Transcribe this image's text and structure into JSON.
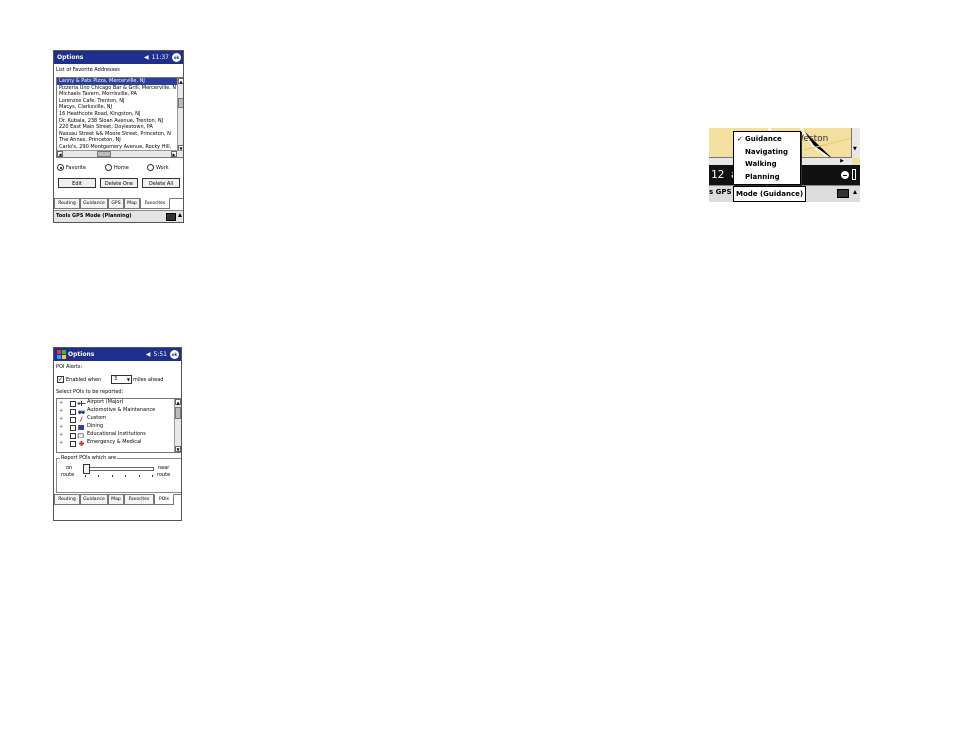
{
  "screen_favorites": {
    "title": "Options",
    "status": "◀  11:37",
    "ok_label": "ok",
    "list_label": "List of Favorite Addresses",
    "addresses": [
      "Lanny & Pats Pizza, Mercerville, NJ",
      "Pizzeria Uno Chicago Bar & Grill, Mercerville, N",
      "Michaels Tavern, Morrisville, PA",
      "Lorenzos Cafe, Trenton, NJ",
      "Macys, Clarksville, NJ",
      "16 Heathcote Road, Kingston, NJ",
      "Dr. Kubala, 238 Sloan Avenue, Trenton, NJ",
      "220 East Main Street, Doylestown, PA",
      "Nassau Street && Moore Street, Princeton, N",
      "The Annex, Princeton, NJ",
      "Carlo's, 290 Montgomery Avenue, Rocky Hill,"
    ],
    "radios": [
      "Favorite",
      "Home",
      "Work"
    ],
    "selected_radio": "Favorite",
    "buttons": {
      "edit": "Edit",
      "delete_one": "Delete One",
      "delete_all": "Delete All"
    },
    "tabs": [
      "Routing",
      "Guidance",
      "GPS",
      "Map",
      "Favorites"
    ],
    "active_tab": "Favorites",
    "command_bar": "Tools GPS Mode (Planning)"
  },
  "screen_pois": {
    "title": "Options",
    "status": "◀  5:51",
    "ok_label": "ok",
    "alerts_label": "POI Alerts:",
    "enabled_label": "Enabled when",
    "miles_value": "3",
    "miles_label": "miles ahead",
    "select_label": "Select POIs to be reported:",
    "pois": [
      "Airport (Major)",
      "Automotive & Maintenance",
      "Custom",
      "Dining",
      "Educational Institutions",
      "Emergency & Medical"
    ],
    "report_label": "Report POIs which are",
    "slider_left": [
      "on",
      "route"
    ],
    "slider_right": [
      "near",
      "route"
    ],
    "tabs": [
      "Routing",
      "Guidance",
      "Map",
      "Favorites",
      "POIs"
    ],
    "active_tab": "POIs"
  },
  "gps_menu": {
    "map_label": "Weston",
    "speed_text": "12 a",
    "items": [
      "Guidance",
      "Navigating",
      "Walking",
      "Planning"
    ],
    "checked_item": "Guidance",
    "bar_prefix": "s GPS",
    "bar_label": "Mode (Guidance)"
  },
  "colors": {
    "title_blue": "#1e2f8e",
    "selection_blue": "#2b3f9b",
    "map_yellow": "#f3dfa0"
  }
}
